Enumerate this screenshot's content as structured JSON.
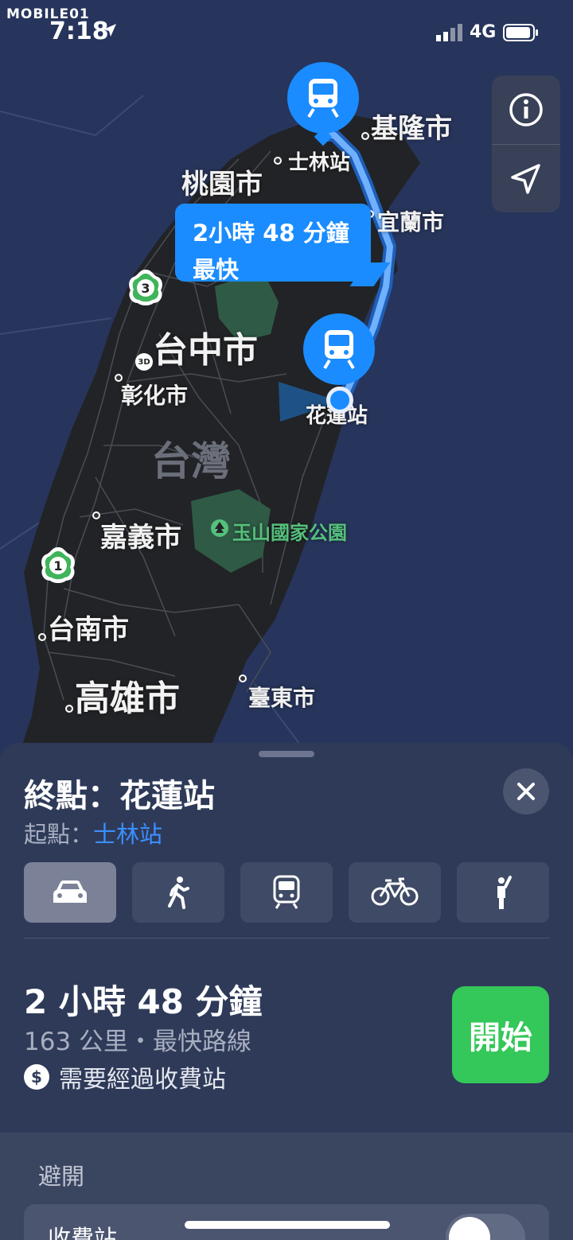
{
  "status_bar": {
    "watermark": "MOBILE01",
    "time": "7:18",
    "network": "4G"
  },
  "map": {
    "labels": {
      "keelung": "基隆市",
      "shilin_station": "士林站",
      "taoyuan": "桃園市",
      "yilan": "宜蘭市",
      "taichung": "台中市",
      "changhua": "彰化市",
      "hualien_station": "花蓮站",
      "taiwan": "台灣",
      "chiayi": "嘉義市",
      "yushan_park": "玉山國家公園",
      "tainan": "台南市",
      "kaohsiung": "高雄市",
      "taitung": "臺東市"
    },
    "highway_badges": [
      "3",
      "1"
    ],
    "badge_3d": "3D",
    "route_bubble": {
      "duration": "2小時 48 分鐘",
      "tag": "最快"
    },
    "colors": {
      "sea": "#27355c",
      "land": "#222326",
      "route": "#3a93ff",
      "park": "#2f5b46"
    }
  },
  "sheet": {
    "destination": "終點：花蓮站",
    "origin_prefix": "起點：",
    "origin_value": "士林站",
    "close_icon": "close-icon",
    "modes": [
      {
        "name": "car-icon",
        "active": true
      },
      {
        "name": "walk-icon",
        "active": false
      },
      {
        "name": "train-icon",
        "active": false
      },
      {
        "name": "bike-icon",
        "active": false
      },
      {
        "name": "rideshare-icon",
        "active": false
      }
    ],
    "duration": "2 小時 48 分鐘",
    "distance": "163 公里・最快路線",
    "toll_symbol": "$",
    "toll_note": "需要經過收費站",
    "go_button": "開始",
    "avoid_title": "避開",
    "avoid_item": "收費站",
    "colors": {
      "go": "#34c759",
      "link": "#3b8fff"
    }
  }
}
